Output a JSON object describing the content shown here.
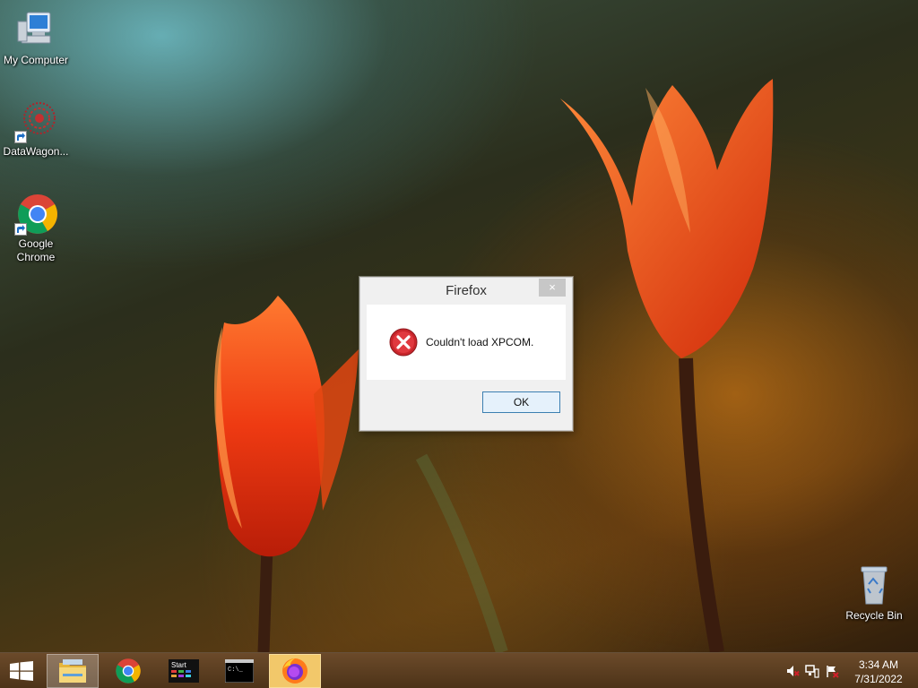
{
  "desktop": {
    "icons": [
      {
        "label": "My Computer"
      },
      {
        "label": "DataWagon..."
      },
      {
        "label": "Google Chrome"
      },
      {
        "label": "Recycle Bin"
      }
    ]
  },
  "dialog": {
    "title": "Firefox",
    "close_label": "×",
    "message": "Couldn't load XPCOM.",
    "ok_label": "OK"
  },
  "taskbar": {
    "buttons": [
      {
        "icon": "windows-logo-icon"
      },
      {
        "icon": "file-explorer-icon"
      },
      {
        "icon": "chrome-icon"
      },
      {
        "icon": "start-tiles-icon",
        "label": "Start"
      },
      {
        "icon": "command-prompt-icon",
        "label": "C:\\_"
      },
      {
        "icon": "firefox-icon"
      }
    ],
    "tray": {
      "time": "3:34 AM",
      "date": "7/31/2022"
    }
  },
  "colors": {
    "taskbar": "#5b3d20",
    "dialog_bg": "#f0f0f0",
    "ok_border": "#3c7fb1",
    "error_red": "#c8252b"
  }
}
